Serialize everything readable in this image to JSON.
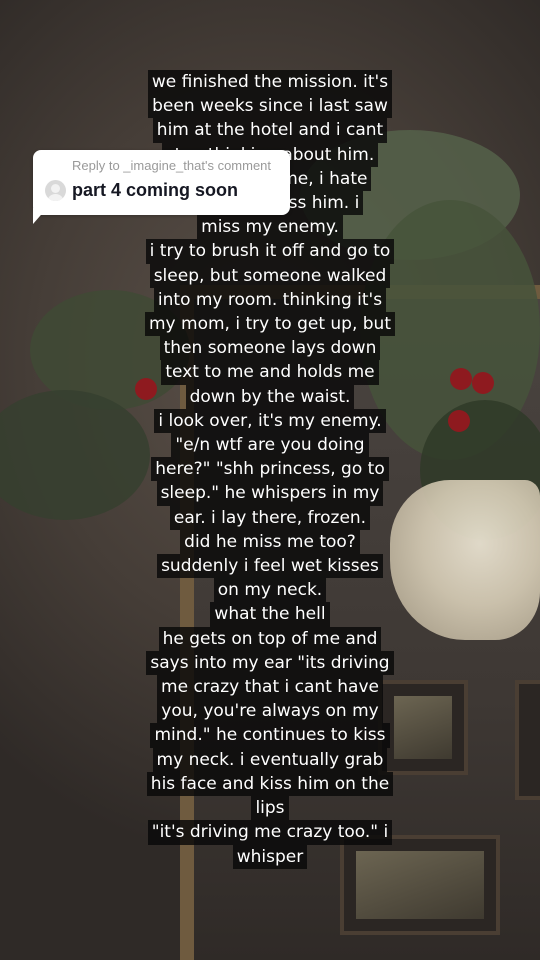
{
  "reply": {
    "header": "Reply to _imagine_that's comment",
    "text": "part 4 coming soon",
    "avatar_icon": "default-avatar-icon"
  },
  "story_lines": [
    "we finished the mission. it's",
    "been weeks since i last saw",
    "him at the hotel and i cant",
    "stop thinking about him.",
    "he betrayed me, i hate",
    "him. but i miss him. i",
    "miss my enemy.",
    "i try to brush it off and go to",
    "sleep, but someone walked",
    "into my room. thinking it's",
    "my mom, i try to get up, but",
    "then someone lays down",
    "text to me and holds me",
    "down by the waist.",
    "i look over, it's my enemy.",
    "\"e/n wtf are you doing",
    "here?\" \"shh princess, go to",
    "sleep.\" he whispers in my",
    "ear. i lay there, frozen.",
    "did he miss me too?",
    "suddenly i feel wet kisses",
    "on my neck.",
    "what the hell",
    "he gets on top of me and",
    "says into my ear \"its driving",
    "me crazy that i cant have",
    "you, you're always on my",
    "mind.\" he continues to kiss",
    "my neck. i eventually grab",
    "his face and kiss him on the",
    "lips",
    "\"it's driving me crazy too.\" i",
    "whisper"
  ],
  "colors": {
    "caption_bg": "#080808",
    "caption_text": "#ffffff",
    "bubble_bg": "#ffffff",
    "bubble_header": "#9a9a9a",
    "bubble_text": "#161823"
  }
}
